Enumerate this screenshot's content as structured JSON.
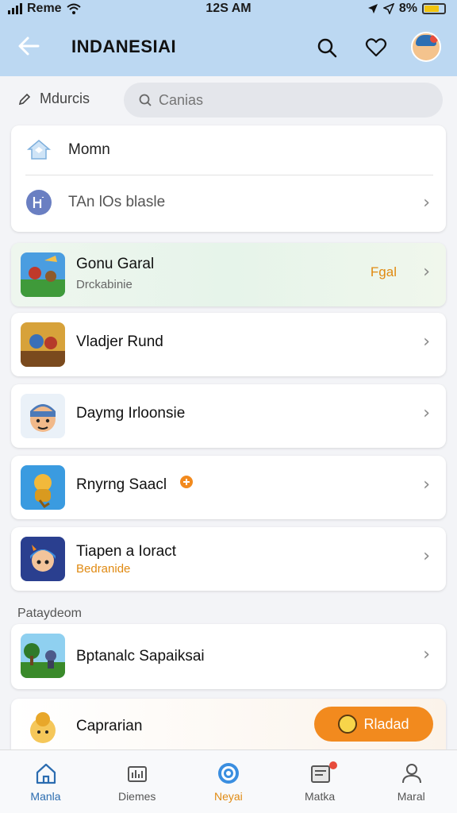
{
  "status": {
    "carrier": "Reme",
    "time": "12S AM",
    "battery": "8%"
  },
  "header": {
    "title": "INDANESIAI"
  },
  "filter": {
    "label": "Mdurcis",
    "search_placeholder": "Canias"
  },
  "top_card": {
    "item1": "Momn",
    "item2": "TAn lOs blasle"
  },
  "games": [
    {
      "name": "Gonu Garal",
      "sub": "Drckabinie",
      "badge": "Fgal"
    },
    {
      "name": "Vladjer Rund",
      "sub": ""
    },
    {
      "name": "Daymg Irloonsie",
      "sub": ""
    },
    {
      "name": "Rnyrng Saacl",
      "sub": ""
    },
    {
      "name": "Tiapen a Ioract",
      "sub": "Bedranide"
    }
  ],
  "section": {
    "label": "Pataydeom"
  },
  "more": [
    {
      "name": "Bptanalc Sapaiksai"
    },
    {
      "name": "Caprarian",
      "button": "Rladad"
    }
  ],
  "nav": [
    {
      "label": "Manla"
    },
    {
      "label": "Diemes"
    },
    {
      "label": "Neyai"
    },
    {
      "label": "Matka"
    },
    {
      "label": "Maral"
    }
  ],
  "colors": {
    "header_bg": "#bcd8f2",
    "accent": "#f28a1e",
    "active_nav": "#e08a12"
  }
}
